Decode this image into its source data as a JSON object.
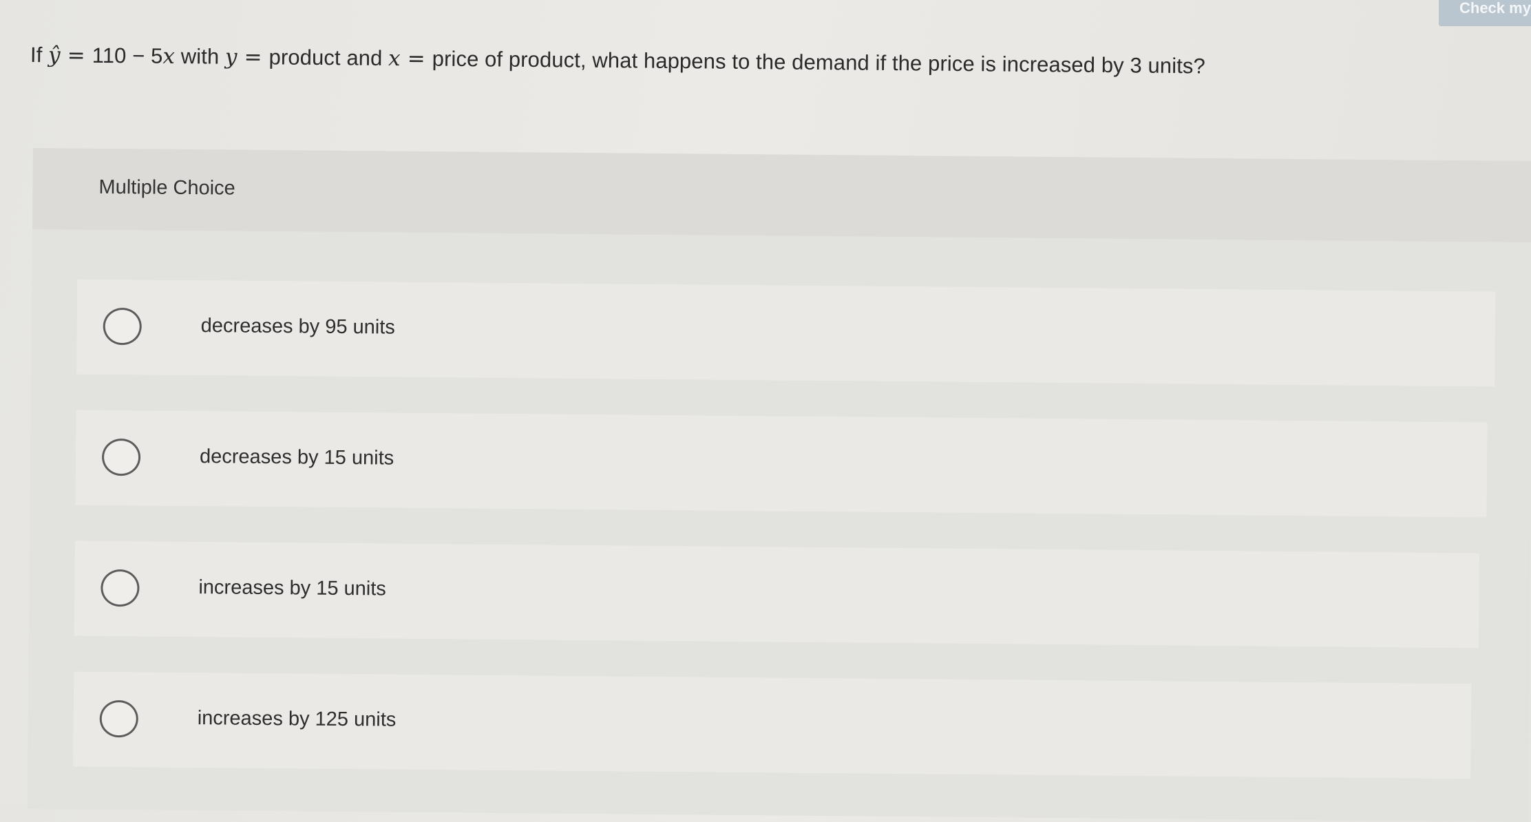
{
  "header": {
    "check_button_label": "Check my"
  },
  "question": {
    "prefix": "If ",
    "yhat": "ŷ",
    "equals_1": " = ",
    "equation_rest": "110 − 5",
    "x_var": "x",
    "with_text": " with ",
    "y_var": "y",
    "equals_2": " = ",
    "product_text": "product and ",
    "x_var_2": "x",
    "equals_3": " = ",
    "rest_text": "price of product, what happens to the demand if the price is increased by 3 units?"
  },
  "multiple_choice": {
    "label": "Multiple Choice",
    "options": [
      {
        "label": "decreases by 95 units",
        "selected": false
      },
      {
        "label": "decreases by 15 units",
        "selected": false
      },
      {
        "label": "increases by 15 units",
        "selected": false
      },
      {
        "label": "increases by 125 units",
        "selected": false
      }
    ]
  }
}
